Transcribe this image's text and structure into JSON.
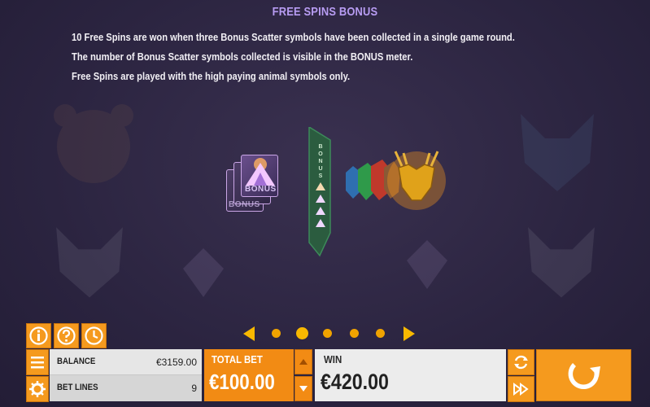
{
  "title": "FREE SPINS BONUS",
  "rules": [
    "10 Free Spins are won when three Bonus Scatter symbols have been collected in a single game round.",
    "The number of Bonus Scatter symbols collected is visible in the BONUS meter.",
    "Free Spins are played with the high paying animal symbols only."
  ],
  "illustration": {
    "scatter_text": "BONUS",
    "meter_text": [
      "B",
      "O",
      "N",
      "U",
      "S"
    ]
  },
  "pagination": {
    "pages": 5,
    "active_index": 1
  },
  "panel": {
    "balance_label": "BALANCE",
    "balance_value": "€3159.00",
    "bet_lines_label": "BET LINES",
    "bet_lines_value": "9",
    "total_bet_label": "TOTAL BET",
    "total_bet_value": "€100.00",
    "win_label": "WIN",
    "win_value": "€420.00"
  },
  "colors": {
    "accent": "#f59a1e",
    "title": "#b79cf2",
    "background": "#2b2440"
  },
  "icons": [
    "info-icon",
    "help-icon",
    "history-icon",
    "menu-icon",
    "settings-icon",
    "autoplay-icon",
    "turbo-icon",
    "spin-icon"
  ]
}
